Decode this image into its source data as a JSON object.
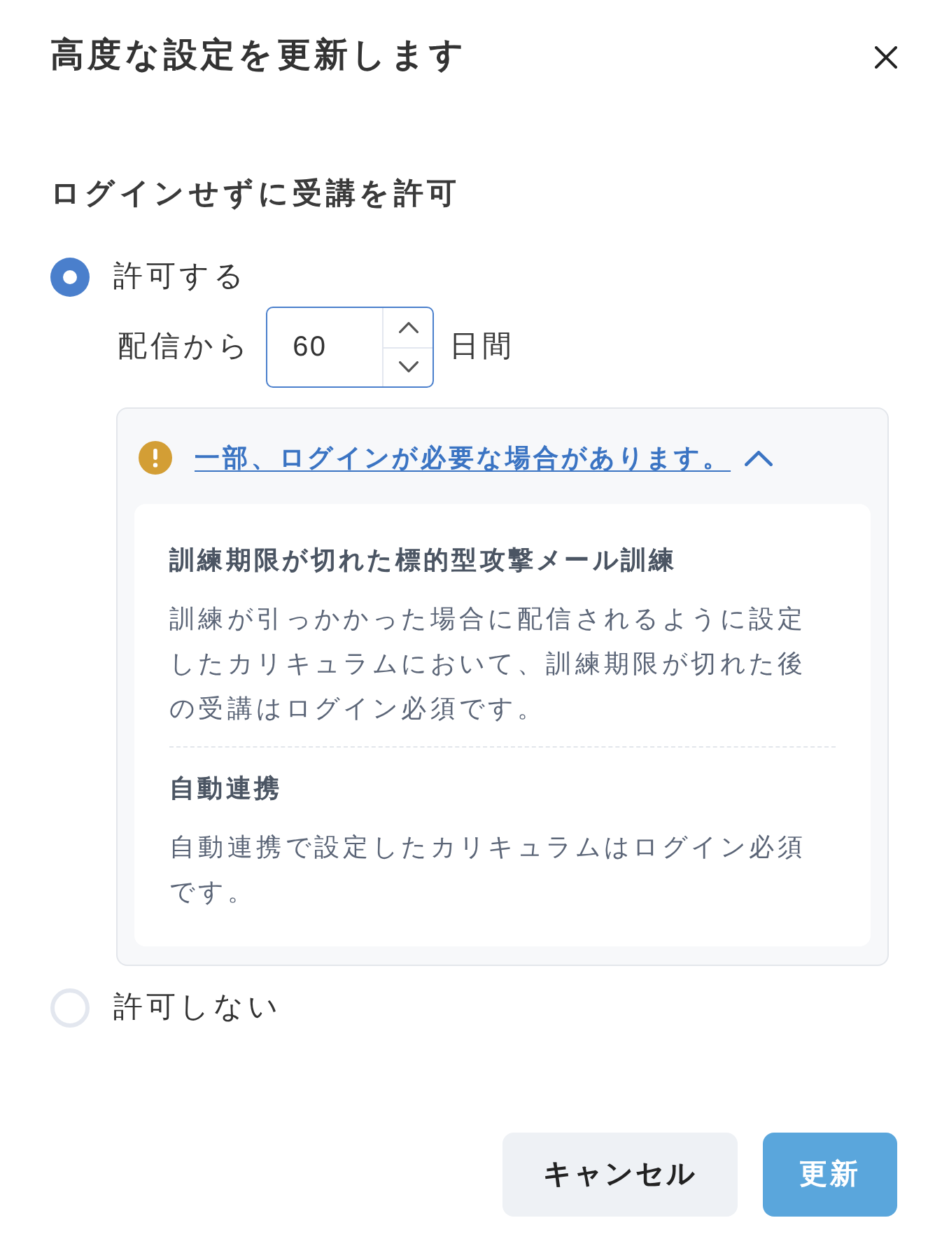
{
  "dialog": {
    "title": "高度な設定を更新します"
  },
  "section": {
    "heading": "ログインせずに受講を許可"
  },
  "options": [
    {
      "label": "許可する",
      "selected": true,
      "kind": "days",
      "prefix": "配信から",
      "input": {
        "value": "60"
      },
      "suffix": "日間",
      "notice": {
        "link": "一部、ログインが必要な場合があります。",
        "expanded": true,
        "items": [
          {
            "heading": "訓練期限が切れた標的型攻撃メール訓練",
            "body": "訓練が引っかかった場合に配信されるように設定したカリキュラムにおいて、訓練期限が切れた後の受講はログイン必須です。"
          },
          {
            "heading": "自動連携",
            "body": "自動連携で設定したカリキュラムはログイン必須です。"
          }
        ]
      }
    },
    {
      "label": "許可しない",
      "selected": false,
      "kind": "plain"
    }
  ],
  "buttons": [
    {
      "label": "キャンセル",
      "kind": "secondary"
    },
    {
      "label": "更新",
      "kind": "primary"
    }
  ]
}
